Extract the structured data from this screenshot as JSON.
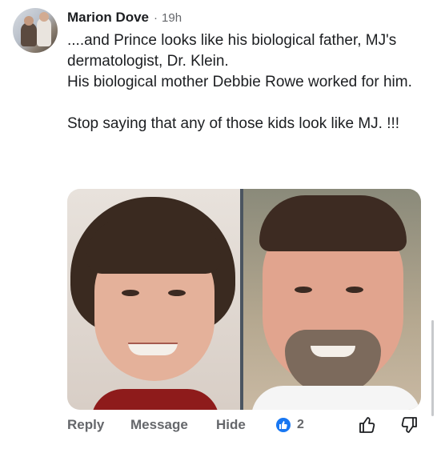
{
  "comment": {
    "author": "Marion Dove",
    "separator": "·",
    "time": "19h",
    "paragraphs": [
      "....and Prince looks like his biological father, MJ's dermatologist, Dr. Klein.",
      "His biological mother Debbie Rowe worked for him.",
      "Stop saying that any of those kids look like MJ. !!!"
    ],
    "avatar_icon": "profile-photo",
    "photo_icon": "side-by-side-portrait-photo"
  },
  "actions": {
    "reply": "Reply",
    "message": "Message",
    "hide": "Hide",
    "like_count": "2",
    "like_badge_icon": "like-badge-icon",
    "like_icon": "thumbs-up-icon",
    "dislike_icon": "thumbs-down-icon"
  },
  "colors": {
    "accent": "#1877f2",
    "muted_text": "#65676b",
    "primary_text": "#1c1e21"
  }
}
